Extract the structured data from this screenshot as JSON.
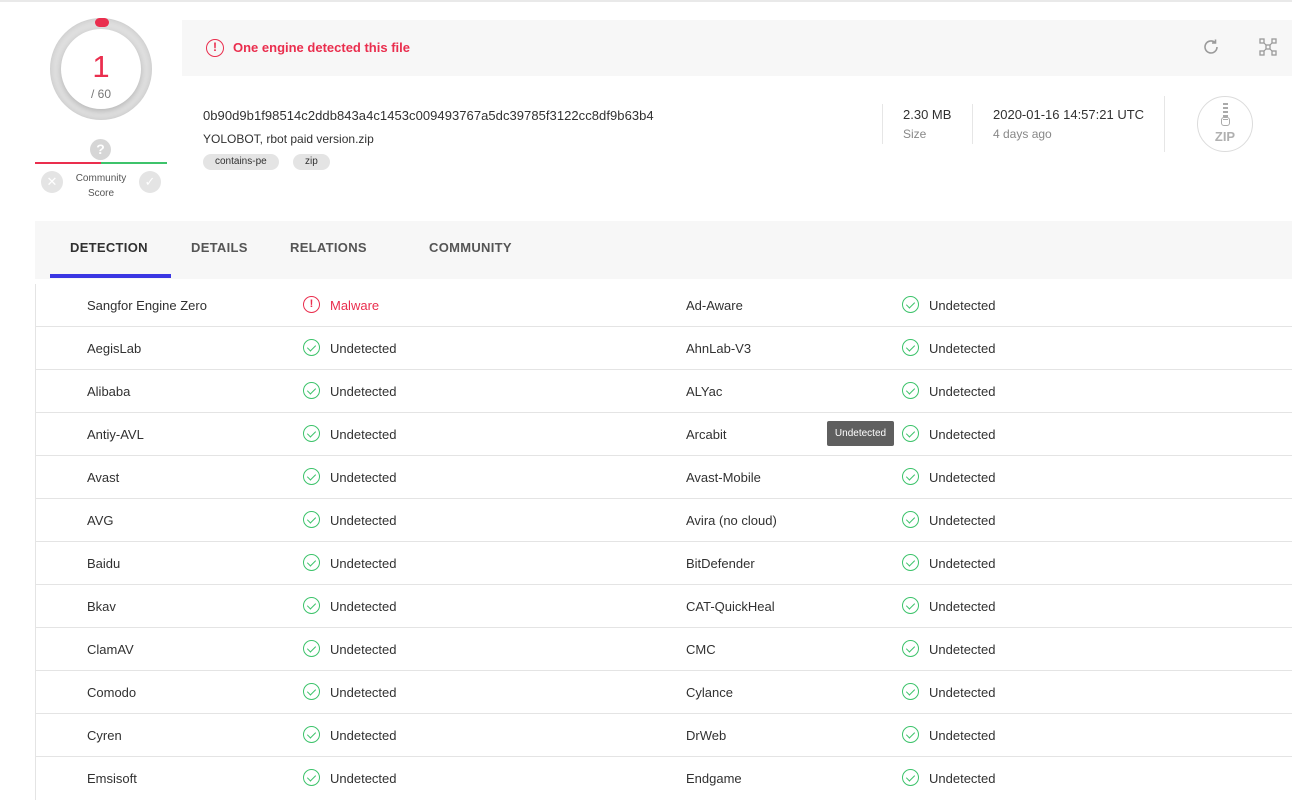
{
  "score": {
    "detections": "1",
    "total": "/ 60"
  },
  "community": {
    "label_line1": "Community",
    "label_line2": "Score",
    "unknown_glyph": "?"
  },
  "banner": {
    "text": "One engine detected this file",
    "icon": "alert-icon"
  },
  "toolbar": {
    "reanalyze_icon": "refresh-icon",
    "similar_icon": "graph-icon"
  },
  "file": {
    "hash": "0b90d9b1f98514c2ddb843a4c1453c009493767a5dc39785f3122cc8df9b63b4",
    "name": "YOLOBOT, rbot paid version.zip",
    "tags": [
      "contains-pe",
      "zip"
    ],
    "size_value": "2.30 MB",
    "size_label": "Size",
    "date_value": "2020-01-16 14:57:21 UTC",
    "date_label": "4 days ago",
    "type_icon_text": "ZIP"
  },
  "tabs": [
    "DETECTION",
    "DETAILS",
    "RELATIONS",
    "COMMUNITY"
  ],
  "tooltip": "Undetected",
  "colors": {
    "malicious": "#ea2e4e",
    "clean": "#3dc36b",
    "accent": "#3b37e3"
  },
  "detections": [
    {
      "left": {
        "engine": "Sangfor Engine Zero",
        "result": "Malware",
        "status": "malicious"
      },
      "right": {
        "engine": "Ad-Aware",
        "result": "Undetected",
        "status": "clean"
      }
    },
    {
      "left": {
        "engine": "AegisLab",
        "result": "Undetected",
        "status": "clean"
      },
      "right": {
        "engine": "AhnLab-V3",
        "result": "Undetected",
        "status": "clean"
      }
    },
    {
      "left": {
        "engine": "Alibaba",
        "result": "Undetected",
        "status": "clean"
      },
      "right": {
        "engine": "ALYac",
        "result": "Undetected",
        "status": "clean"
      }
    },
    {
      "left": {
        "engine": "Antiy-AVL",
        "result": "Undetected",
        "status": "clean"
      },
      "right": {
        "engine": "Arcabit",
        "result": "Undetected",
        "status": "clean"
      }
    },
    {
      "left": {
        "engine": "Avast",
        "result": "Undetected",
        "status": "clean"
      },
      "right": {
        "engine": "Avast-Mobile",
        "result": "Undetected",
        "status": "clean"
      }
    },
    {
      "left": {
        "engine": "AVG",
        "result": "Undetected",
        "status": "clean"
      },
      "right": {
        "engine": "Avira (no cloud)",
        "result": "Undetected",
        "status": "clean"
      }
    },
    {
      "left": {
        "engine": "Baidu",
        "result": "Undetected",
        "status": "clean"
      },
      "right": {
        "engine": "BitDefender",
        "result": "Undetected",
        "status": "clean"
      }
    },
    {
      "left": {
        "engine": "Bkav",
        "result": "Undetected",
        "status": "clean"
      },
      "right": {
        "engine": "CAT-QuickHeal",
        "result": "Undetected",
        "status": "clean"
      }
    },
    {
      "left": {
        "engine": "ClamAV",
        "result": "Undetected",
        "status": "clean"
      },
      "right": {
        "engine": "CMC",
        "result": "Undetected",
        "status": "clean"
      }
    },
    {
      "left": {
        "engine": "Comodo",
        "result": "Undetected",
        "status": "clean"
      },
      "right": {
        "engine": "Cylance",
        "result": "Undetected",
        "status": "clean"
      }
    },
    {
      "left": {
        "engine": "Cyren",
        "result": "Undetected",
        "status": "clean"
      },
      "right": {
        "engine": "DrWeb",
        "result": "Undetected",
        "status": "clean"
      }
    },
    {
      "left": {
        "engine": "Emsisoft",
        "result": "Undetected",
        "status": "clean"
      },
      "right": {
        "engine": "Endgame",
        "result": "Undetected",
        "status": "clean"
      }
    }
  ]
}
